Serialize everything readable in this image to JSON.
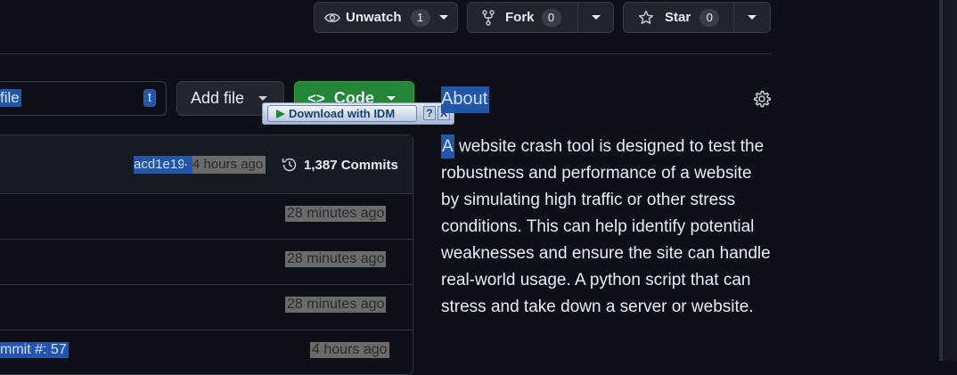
{
  "header": {
    "unwatch": {
      "label": "Unwatch",
      "count": "1"
    },
    "fork": {
      "label": "Fork",
      "count": "0"
    },
    "star": {
      "label": "Star",
      "count": "0"
    }
  },
  "toolbar": {
    "search_fragment": "file",
    "shortcut_key": "t",
    "add_file_label": "Add file",
    "code_label": "Code"
  },
  "idm": {
    "label": "Download with IDM",
    "help": "?",
    "close": "X"
  },
  "commit_bar": {
    "hash": "acd1e19",
    "separator": " · ",
    "time": "4 hours ago",
    "commits_label": "1,387 Commits"
  },
  "file_rows": [
    {
      "message": "",
      "time": "28 minutes ago"
    },
    {
      "message": "",
      "time": "28 minutes ago"
    },
    {
      "message": "",
      "time": "28 minutes ago"
    },
    {
      "message": "mmit #: 57",
      "time": "4 hours ago"
    }
  ],
  "about": {
    "title": "About",
    "first_letter": "A",
    "description": " website crash tool is designed to test the robustness and performance of a website by simulating high traffic or other stress conditions. This can help identify potential weaknesses and ensure the site can handle real-world usage. A python script that can stress and take down a server or website."
  },
  "colors": {
    "background": "#0d1117",
    "code_button": "#238636",
    "selection": "#2356a8"
  }
}
